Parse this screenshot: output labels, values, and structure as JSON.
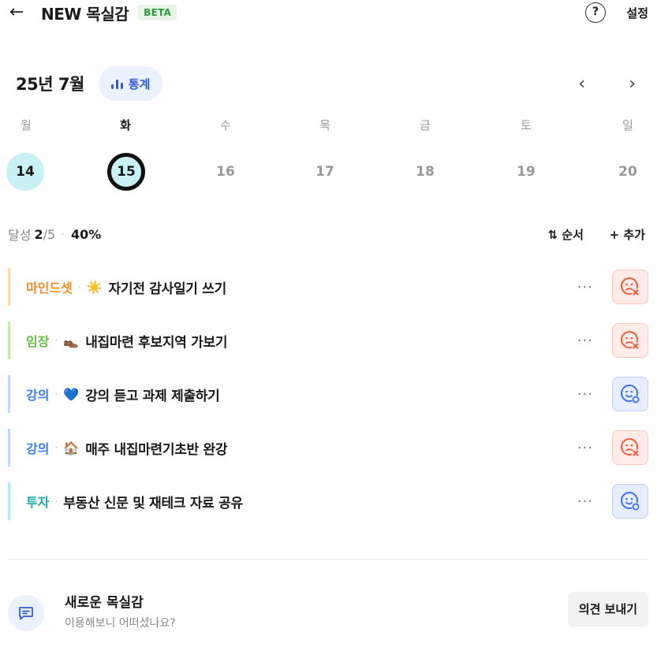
{
  "header": {
    "back_icon": "arrow-left-icon",
    "title": "NEW 목실감",
    "badge": "BETA",
    "help_label": "?",
    "settings_label": "설정"
  },
  "calendar": {
    "month_label": "25년 7월",
    "stats_label": "통계",
    "prev_label": "‹",
    "next_label": "›",
    "weekdays": [
      "월",
      "화",
      "수",
      "목",
      "금",
      "토",
      "일"
    ],
    "dates": [
      "14",
      "15",
      "16",
      "17",
      "18",
      "19",
      "20"
    ],
    "today_index": 1,
    "done_index": 0
  },
  "progress": {
    "label": "달성",
    "done": "2",
    "total": "/5",
    "percent": "40%",
    "order_label": "⇅ 순서",
    "add_label": "+ 추가"
  },
  "goals": [
    {
      "category": "마인드셋",
      "emoji": "☀️",
      "title": "자기전 감사일기 쓰기",
      "color": "#f28c28",
      "bar": "#ffd9a8",
      "status": "fail"
    },
    {
      "category": "임장",
      "emoji": "👞",
      "title": "내집마련 후보지역 가보기",
      "color": "#6abd45",
      "bar": "#c7e9b0",
      "status": "fail"
    },
    {
      "category": "강의",
      "emoji": "💙",
      "title": "강의 듣고 과제 제출하기",
      "color": "#3d7cf5",
      "bar": "#c4d7ff",
      "status": "pending"
    },
    {
      "category": "강의",
      "emoji": "🏠",
      "title": "매주 내집마련기초반 완강",
      "color": "#3d7cf5",
      "bar": "#c4d7ff",
      "status": "fail"
    },
    {
      "category": "투자",
      "emoji": "",
      "title": "부동산 신문 및 재테크 자료 공유",
      "color": "#1fa9a9",
      "bar": "#b2ebeb",
      "status": "pending"
    }
  ],
  "more_label": "···",
  "footer": {
    "title": "새로운 목실감",
    "subtitle": "이용해보니 어떠셨나요?",
    "button_label": "의견 보내기"
  },
  "colors": {
    "accent": "#2f5bd6",
    "fail": "#f25a3c",
    "pending": "#3d6df2",
    "today_fill": "#c9f0f4"
  }
}
